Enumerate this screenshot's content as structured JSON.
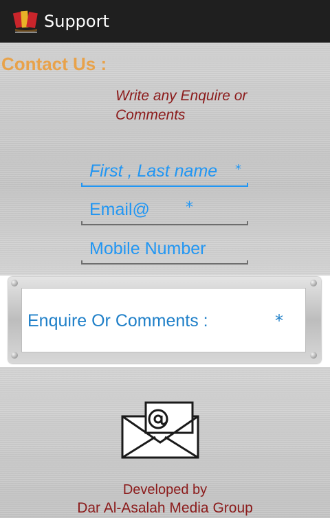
{
  "action_bar": {
    "title": "Support",
    "icon": "app-logo-icon",
    "bg_color": "#1f1f1f"
  },
  "form": {
    "heading": "Contact Us :",
    "instruction": "Write any Enquire or Comments",
    "name_field": {
      "placeholder": "First , Last name",
      "required_mark": "*"
    },
    "email_field": {
      "placeholder": "Email@",
      "required_mark": "*"
    },
    "mobile_field": {
      "placeholder": "Mobile Number"
    },
    "comments_field": {
      "placeholder": "Enquire Or Comments :",
      "required_mark": "*"
    },
    "accent_color": "#2196f3",
    "heading_color": "#e8a24a",
    "instruction_color": "#8b1a1a"
  },
  "send_icon": "envelope-at-icon",
  "footer": {
    "line1": "Developed by",
    "line2": "Dar Al-Asalah Media Group"
  }
}
